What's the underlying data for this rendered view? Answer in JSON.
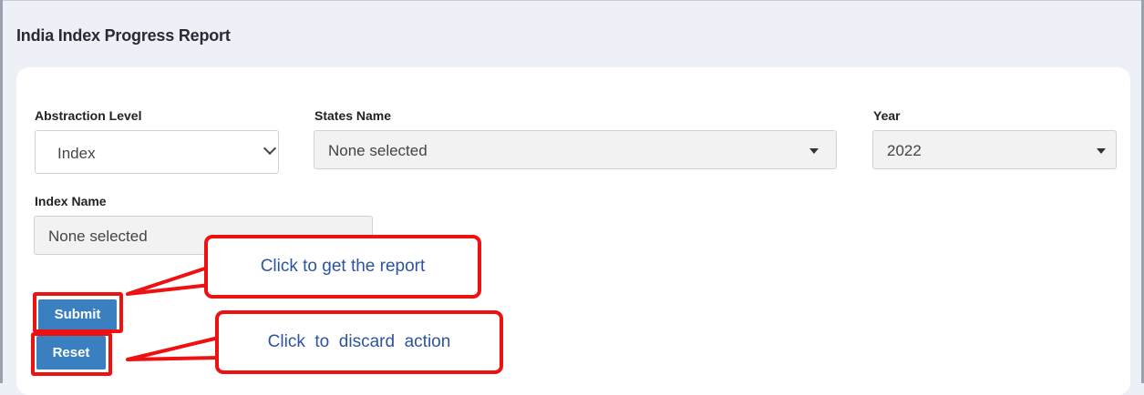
{
  "page": {
    "title": "India Index Progress Report"
  },
  "form": {
    "abstraction_level": {
      "label": "Abstraction Level",
      "value": "Index"
    },
    "states_name": {
      "label": "States Name",
      "value": "None selected"
    },
    "year": {
      "label": "Year",
      "value": "2022"
    },
    "index_name": {
      "label": "Index Name",
      "value": "None selected"
    }
  },
  "buttons": {
    "submit": "Submit",
    "reset": "Reset"
  },
  "annotations": {
    "submit_callout": "Click to get the report",
    "reset_callout": "Click  to  discard  action",
    "highlight_color": "#ee1111",
    "callout_text_color": "#2c54a0"
  },
  "colors": {
    "button": "#3a7fc0",
    "background": "#eef0f8",
    "card": "#ffffff"
  }
}
